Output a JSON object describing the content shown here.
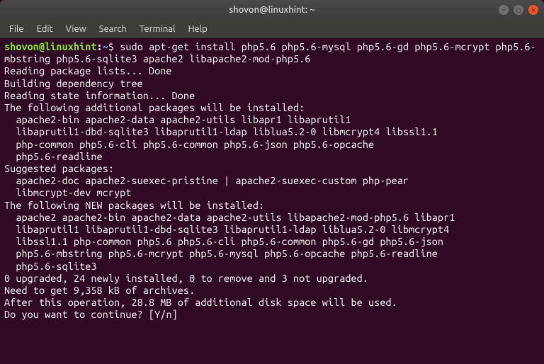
{
  "window": {
    "title": "shovon@linuxhint: ~"
  },
  "menu": {
    "file": "File",
    "edit": "Edit",
    "view": "View",
    "search": "Search",
    "terminal": "Terminal",
    "help": "Help"
  },
  "prompt": {
    "user_host": "shovon@linuxhint",
    "colon": ":",
    "path": "~",
    "symbol": "$"
  },
  "command": "sudo apt-get install php5.6 php5.6-mysql php5.6-gd php5.6-mcrypt php5.6-mbstring php5.6-sqlite3 apache2 libapache2-mod-php5.6",
  "output": {
    "l1": "Reading package lists... Done",
    "l2": "Building dependency tree",
    "l3": "Reading state information... Done",
    "l4": "The following additional packages will be installed:",
    "l5": "  apache2-bin apache2-data apache2-utils libapr1 libaprutil1",
    "l6": "  libaprutil1-dbd-sqlite3 libaprutil1-ldap liblua5.2-0 libmcrypt4 libssl1.1",
    "l7": "  php-common php5.6-cli php5.6-common php5.6-json php5.6-opcache",
    "l8": "  php5.6-readline",
    "l9": "Suggested packages:",
    "l10": "  apache2-doc apache2-suexec-pristine | apache2-suexec-custom php-pear",
    "l11": "  libmcrypt-dev mcrypt",
    "l12": "The following NEW packages will be installed:",
    "l13": "  apache2 apache2-bin apache2-data apache2-utils libapache2-mod-php5.6 libapr1",
    "l14": "  libaprutil1 libaprutil1-dbd-sqlite3 libaprutil1-ldap liblua5.2-0 libmcrypt4",
    "l15": "  libssl1.1 php-common php5.6 php5.6-cli php5.6-common php5.6-gd php5.6-json",
    "l16": "  php5.6-mbstring php5.6-mcrypt php5.6-mysql php5.6-opcache php5.6-readline",
    "l17": "  php5.6-sqlite3",
    "l18": "0 upgraded, 24 newly installed, 0 to remove and 3 not upgraded.",
    "l19": "Need to get 9,358 kB of archives.",
    "l20": "After this operation, 28.8 MB of additional disk space will be used.",
    "l21": "Do you want to continue? [Y/n] "
  },
  "controls": {
    "min": "–",
    "max": "□",
    "close": "✕"
  }
}
